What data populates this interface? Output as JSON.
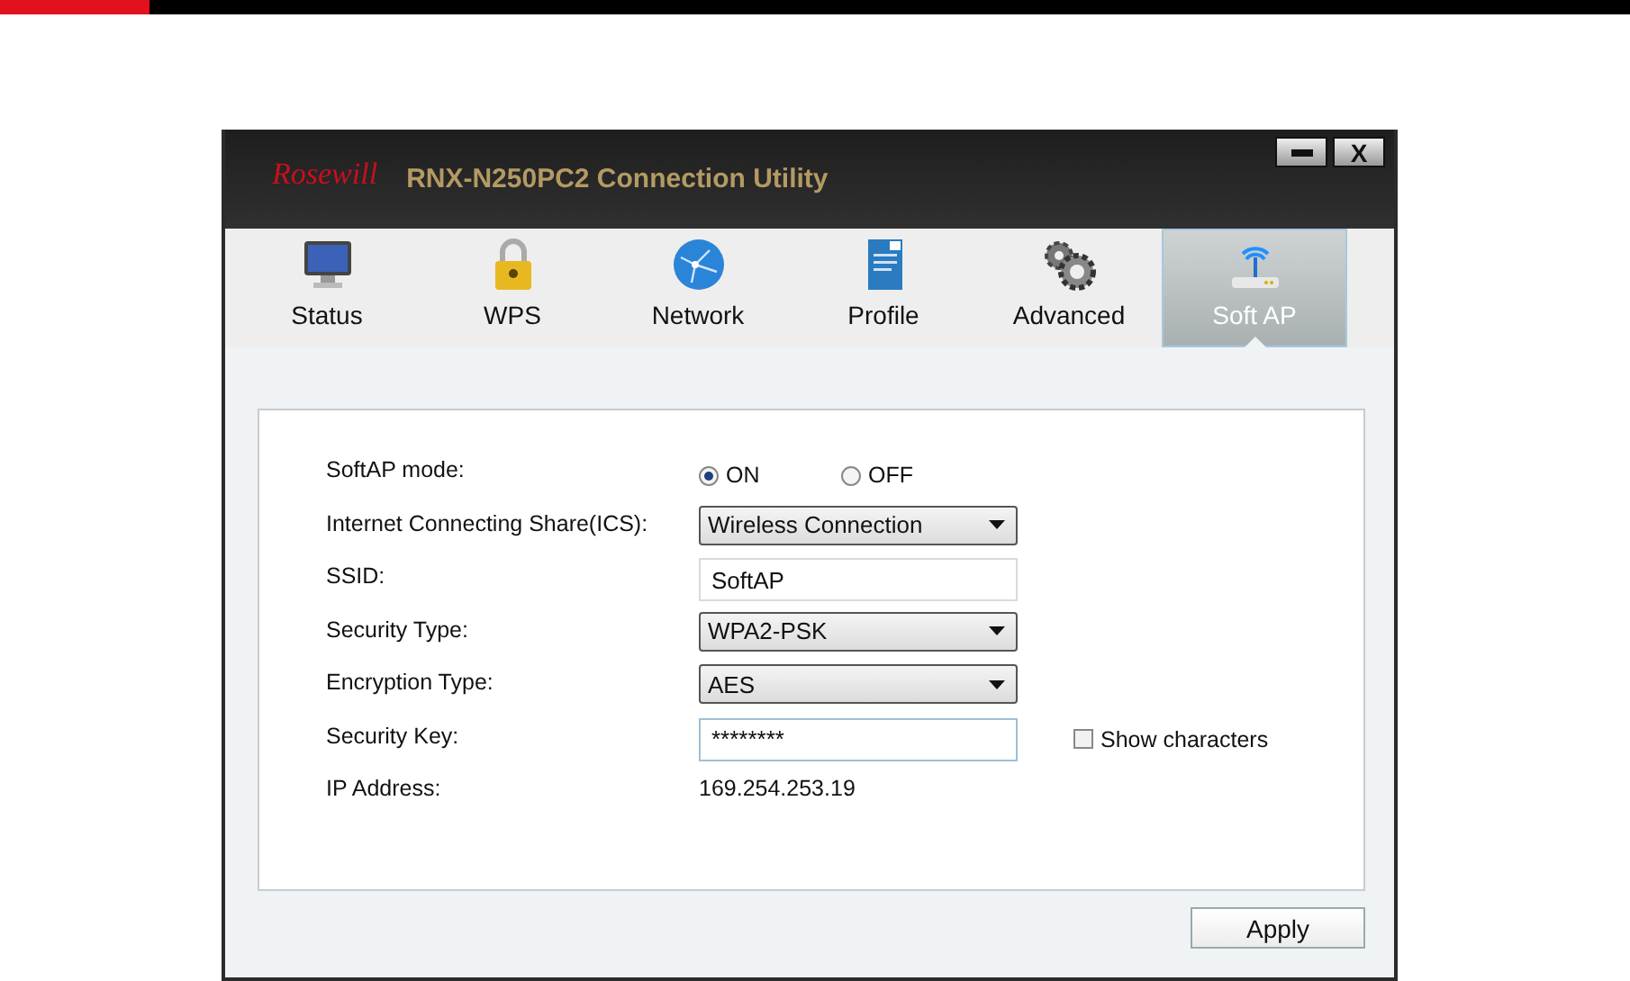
{
  "window": {
    "logo": "Rosewill",
    "title": "RNX-N250PC2 Connection Utility",
    "close_label": "X"
  },
  "tabs": [
    {
      "label": "Status",
      "kind": "monitor",
      "selected": false
    },
    {
      "label": "WPS",
      "kind": "lock",
      "selected": false
    },
    {
      "label": "Network",
      "kind": "globe",
      "selected": false
    },
    {
      "label": "Profile",
      "kind": "document",
      "selected": false
    },
    {
      "label": "Advanced",
      "kind": "gears",
      "selected": false
    },
    {
      "label": "Soft AP",
      "kind": "router",
      "selected": true
    }
  ],
  "form": [
    {
      "kind": "radio",
      "label": "SoftAP mode:",
      "options": [
        {
          "label": "ON",
          "selected": true
        },
        {
          "label": "OFF",
          "selected": false
        }
      ]
    },
    {
      "kind": "select",
      "label": "Internet Connecting Share(ICS):",
      "value": "Wireless Connection"
    },
    {
      "kind": "text",
      "label": "SSID:",
      "value": "SoftAP"
    },
    {
      "kind": "select",
      "label": "Security Type:",
      "value": "WPA2-PSK"
    },
    {
      "kind": "select",
      "label": "Encryption Type:",
      "value": "AES"
    },
    {
      "kind": "password",
      "label": "Security Key:",
      "value": "********",
      "focused": true,
      "checkbox": {
        "label": "Show characters",
        "checked": false
      }
    },
    {
      "kind": "static",
      "label": "IP Address:",
      "value": "169.254.253.19"
    }
  ],
  "buttons": [
    {
      "label": "Apply"
    }
  ]
}
